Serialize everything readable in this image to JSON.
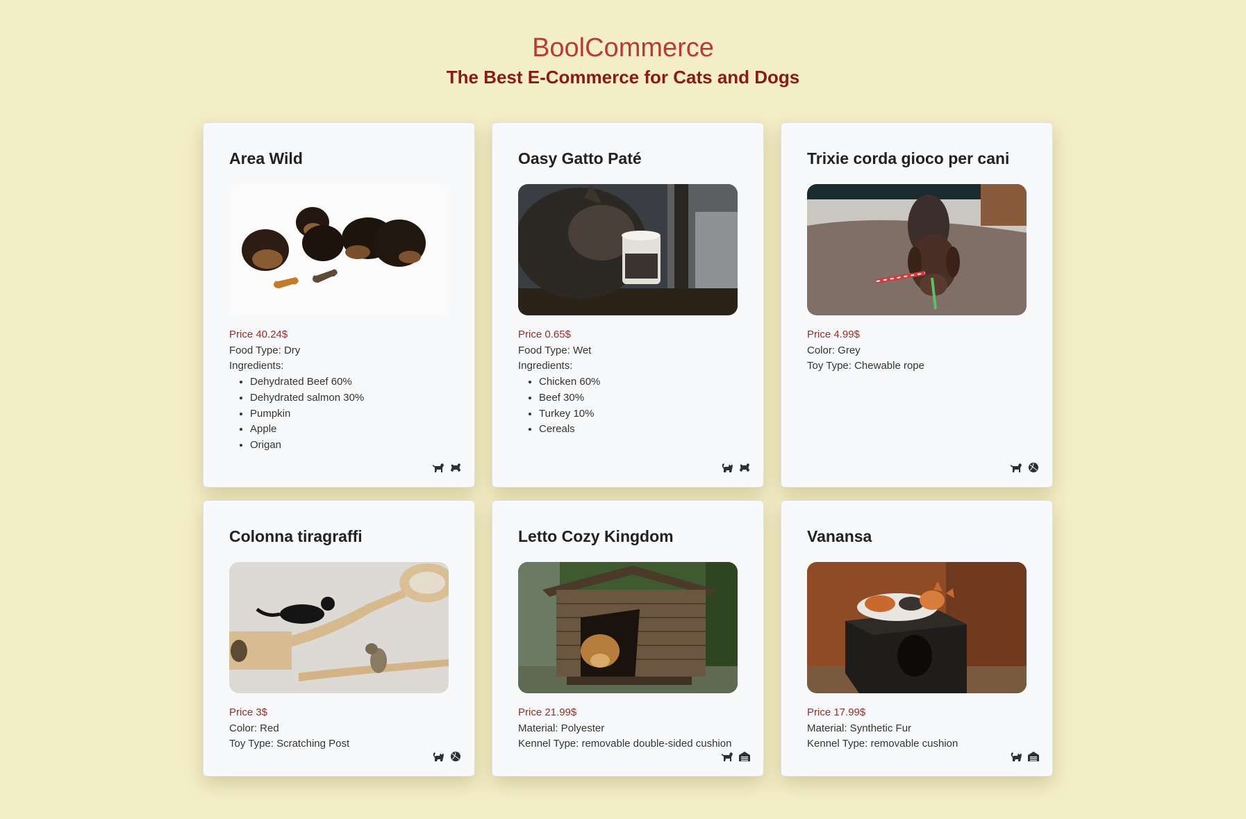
{
  "header": {
    "brand": "BoolCommerce",
    "tagline": "The Best E-Commerce for Cats and Dogs"
  },
  "colors": {
    "background": "#f4eec6",
    "brand": "#b73b36",
    "tagline": "#8a1a16",
    "price": "#9b2a26",
    "card": "#f8f9fa"
  },
  "products": [
    {
      "title": "Area Wild",
      "image": "puppies-eating-biscuits",
      "price": "Price 40.24$",
      "lines": [
        "Food Type: Dry",
        "Ingredients:"
      ],
      "list": [
        "Dehydrated Beef 60%",
        "Dehydrated salmon 30%",
        "Pumpkin",
        "Apple",
        "Origan"
      ],
      "icons": [
        "dog-icon",
        "bone-icon"
      ]
    },
    {
      "title": "Oasy Gatto Paté",
      "image": "cat-with-food-jar",
      "price": "Price 0.65$",
      "lines": [
        "Food Type: Wet",
        "Ingredients:"
      ],
      "list": [
        "Chicken 60%",
        "Beef 30%",
        "Turkey 10%",
        "Cereals"
      ],
      "icons": [
        "cat-icon",
        "bone-icon"
      ]
    },
    {
      "title": "Trixie corda gioco per cani",
      "image": "dog-with-rope-toy",
      "price": "Price 4.99$",
      "lines": [
        "Color: Grey",
        "Toy Type: Chewable rope"
      ],
      "list": [],
      "icons": [
        "dog-icon",
        "ball-icon"
      ]
    },
    {
      "title": "Colonna tiragraffi",
      "image": "cats-on-wall-shelves",
      "price": "Price 3$",
      "lines": [
        "Color: Red",
        "Toy Type: Scratching Post"
      ],
      "list": [],
      "icons": [
        "cat-icon",
        "ball-icon"
      ]
    },
    {
      "title": "Letto Cozy Kingdom",
      "image": "dog-in-wooden-kennel",
      "price": "Price 21.99$",
      "lines": [
        "Material: Polyester",
        "Kennel Type: removable double-sided cushion"
      ],
      "list": [],
      "icons": [
        "dog-icon",
        "kennel-icon"
      ]
    },
    {
      "title": "Vanansa",
      "image": "cat-sleeping-on-box",
      "price": "Price 17.99$",
      "lines": [
        "Material: Synthetic Fur",
        "Kennel Type: removable cushion"
      ],
      "list": [],
      "icons": [
        "cat-icon",
        "kennel-icon"
      ]
    }
  ]
}
